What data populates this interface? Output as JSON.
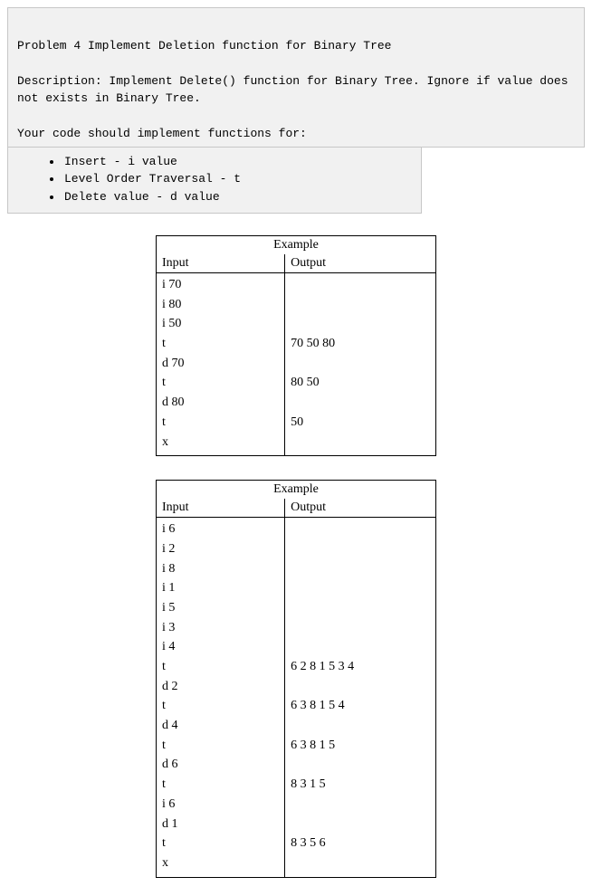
{
  "problem": {
    "title": "Problem 4 Implement Deletion function for Binary Tree",
    "description": "Description: Implement Delete() function for Binary Tree. Ignore if value does not exists in Binary Tree.",
    "instructions_label": "Your code should implement functions for:",
    "bullets": [
      "Insert - i value",
      "Level Order Traversal - t",
      "Delete value - d value"
    ]
  },
  "tables": [
    {
      "caption": "Example",
      "col_input": "Input",
      "col_output": "Output",
      "rows": [
        {
          "in": "i 70",
          "out": ""
        },
        {
          "in": "i 80",
          "out": ""
        },
        {
          "in": "i 50",
          "out": ""
        },
        {
          "in": "t",
          "out": "70 50 80"
        },
        {
          "in": "d 70",
          "out": ""
        },
        {
          "in": "t",
          "out": "80 50"
        },
        {
          "in": "d 80",
          "out": ""
        },
        {
          "in": "t",
          "out": "50"
        },
        {
          "in": "x",
          "out": ""
        }
      ]
    },
    {
      "caption": "Example",
      "col_input": "Input",
      "col_output": "Output",
      "rows": [
        {
          "in": "i 6",
          "out": ""
        },
        {
          "in": "i 2",
          "out": ""
        },
        {
          "in": "i 8",
          "out": ""
        },
        {
          "in": "i 1",
          "out": ""
        },
        {
          "in": "i 5",
          "out": ""
        },
        {
          "in": "i 3",
          "out": ""
        },
        {
          "in": "i 4",
          "out": ""
        },
        {
          "in": "t",
          "out": "6 2 8 1 5 3 4"
        },
        {
          "in": "d 2",
          "out": ""
        },
        {
          "in": "t",
          "out": "6 3 8 1 5 4"
        },
        {
          "in": "d 4",
          "out": ""
        },
        {
          "in": "t",
          "out": "6 3 8 1 5"
        },
        {
          "in": "d 6",
          "out": ""
        },
        {
          "in": "t",
          "out": "8 3 1 5"
        },
        {
          "in": "i 6",
          "out": ""
        },
        {
          "in": "d 1",
          "out": ""
        },
        {
          "in": "t",
          "out": "8 3 5 6"
        },
        {
          "in": "x",
          "out": ""
        }
      ]
    }
  ]
}
